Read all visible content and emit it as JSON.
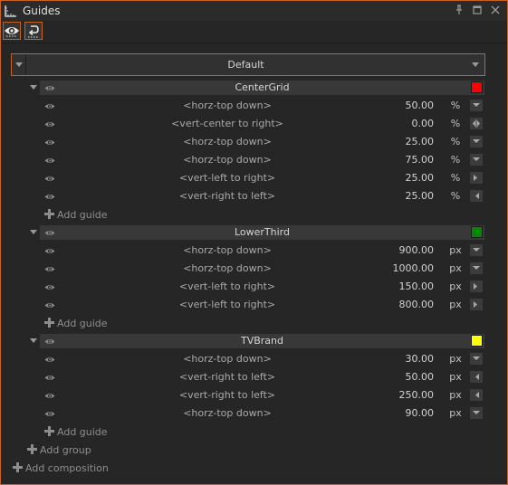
{
  "window": {
    "title": "Guides"
  },
  "composition": {
    "name": "Default"
  },
  "groups": [
    {
      "name": "CenterGrid",
      "color": "#ff0000",
      "guides": [
        {
          "direction": "<horz-top down>",
          "value": "50.00",
          "unit": "%"
        },
        {
          "direction": "<vert-center to right>",
          "value": "0.00",
          "unit": "%"
        },
        {
          "direction": "<horz-top down>",
          "value": "25.00",
          "unit": "%"
        },
        {
          "direction": "<horz-top down>",
          "value": "75.00",
          "unit": "%"
        },
        {
          "direction": "<vert-left to right>",
          "value": "25.00",
          "unit": "%"
        },
        {
          "direction": "<vert-right to left>",
          "value": "25.00",
          "unit": "%"
        }
      ],
      "add_label": "Add guide"
    },
    {
      "name": "LowerThird",
      "color": "#008800",
      "guides": [
        {
          "direction": "<horz-top down>",
          "value": "900.00",
          "unit": "px"
        },
        {
          "direction": "<horz-top down>",
          "value": "1000.00",
          "unit": "px"
        },
        {
          "direction": "<vert-left to right>",
          "value": "150.00",
          "unit": "px"
        },
        {
          "direction": "<vert-left to right>",
          "value": "800.00",
          "unit": "px"
        }
      ],
      "add_label": "Add guide"
    },
    {
      "name": "TVBrand",
      "color": "#ffff00",
      "guides": [
        {
          "direction": "<horz-top down>",
          "value": "30.00",
          "unit": "px"
        },
        {
          "direction": "<vert-right to left>",
          "value": "50.00",
          "unit": "px"
        },
        {
          "direction": "<vert-right to left>",
          "value": "250.00",
          "unit": "px"
        },
        {
          "direction": "<horz-top down>",
          "value": "90.00",
          "unit": "px"
        }
      ],
      "add_label": "Add guide"
    }
  ],
  "add_group_label": "Add group",
  "add_composition_label": "Add composition",
  "colors": {
    "accent_border": "#c8621c",
    "panel_bg": "#262626"
  }
}
